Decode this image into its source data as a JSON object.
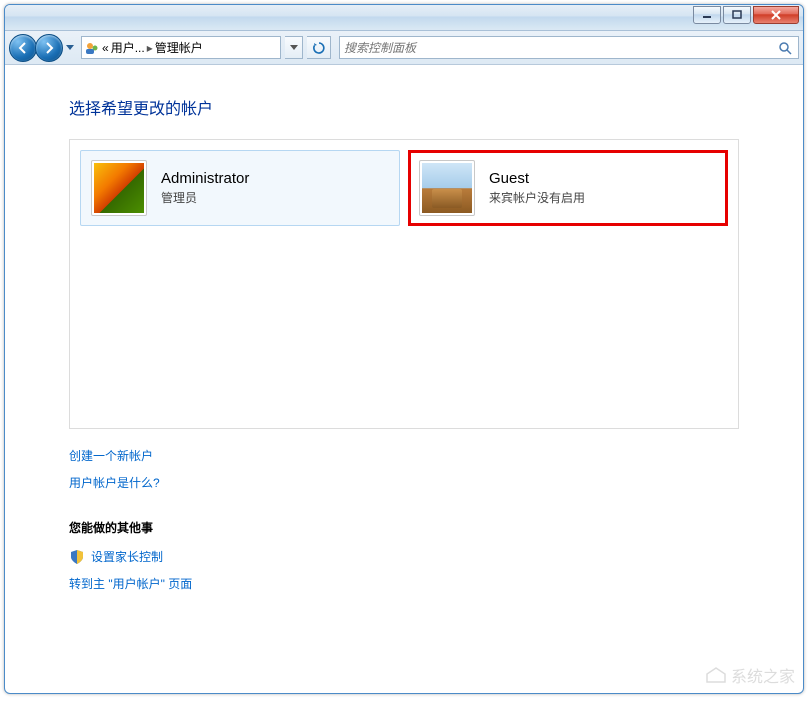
{
  "breadcrumb": {
    "prefix": "«",
    "item1": "用户...",
    "sep": "▸",
    "item2": "管理帐户"
  },
  "search": {
    "placeholder": "搜索控制面板"
  },
  "page": {
    "heading": "选择希望更改的帐户",
    "accounts": [
      {
        "name": "Administrator",
        "subtitle": "管理员"
      },
      {
        "name": "Guest",
        "subtitle": "来宾帐户没有启用"
      }
    ],
    "links": {
      "create": "创建一个新帐户",
      "whatis": "用户帐户是什么?"
    },
    "other": {
      "heading": "您能做的其他事",
      "parental": "设置家长控制",
      "goto": "转到主 \"用户帐户\" 页面"
    }
  },
  "watermark": "系统之家"
}
